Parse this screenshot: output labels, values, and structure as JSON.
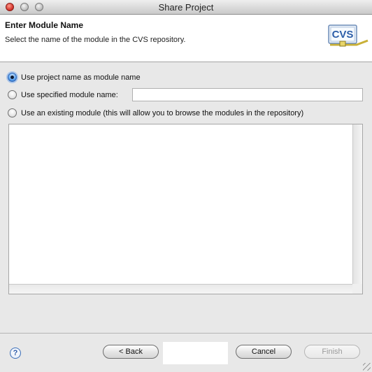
{
  "window": {
    "title": "Share Project"
  },
  "header": {
    "title": "Enter Module Name",
    "description": "Select the name of the module in the CVS repository.",
    "logo_text": "CVS",
    "logo_icon": "cvs-icon"
  },
  "options": [
    {
      "label": "Use project name as module name",
      "checked": true
    },
    {
      "label": "Use specified module name:",
      "checked": false
    },
    {
      "label": "Use an existing module (this will allow you to browse the modules in the repository)",
      "checked": false
    }
  ],
  "module_name_field": {
    "value": "",
    "placeholder": ""
  },
  "buttons": {
    "help_icon": "help-icon",
    "back": "< Back",
    "next": "",
    "cancel": "Cancel",
    "finish": "Finish"
  },
  "colors": {
    "accent": "#2f67b8"
  }
}
